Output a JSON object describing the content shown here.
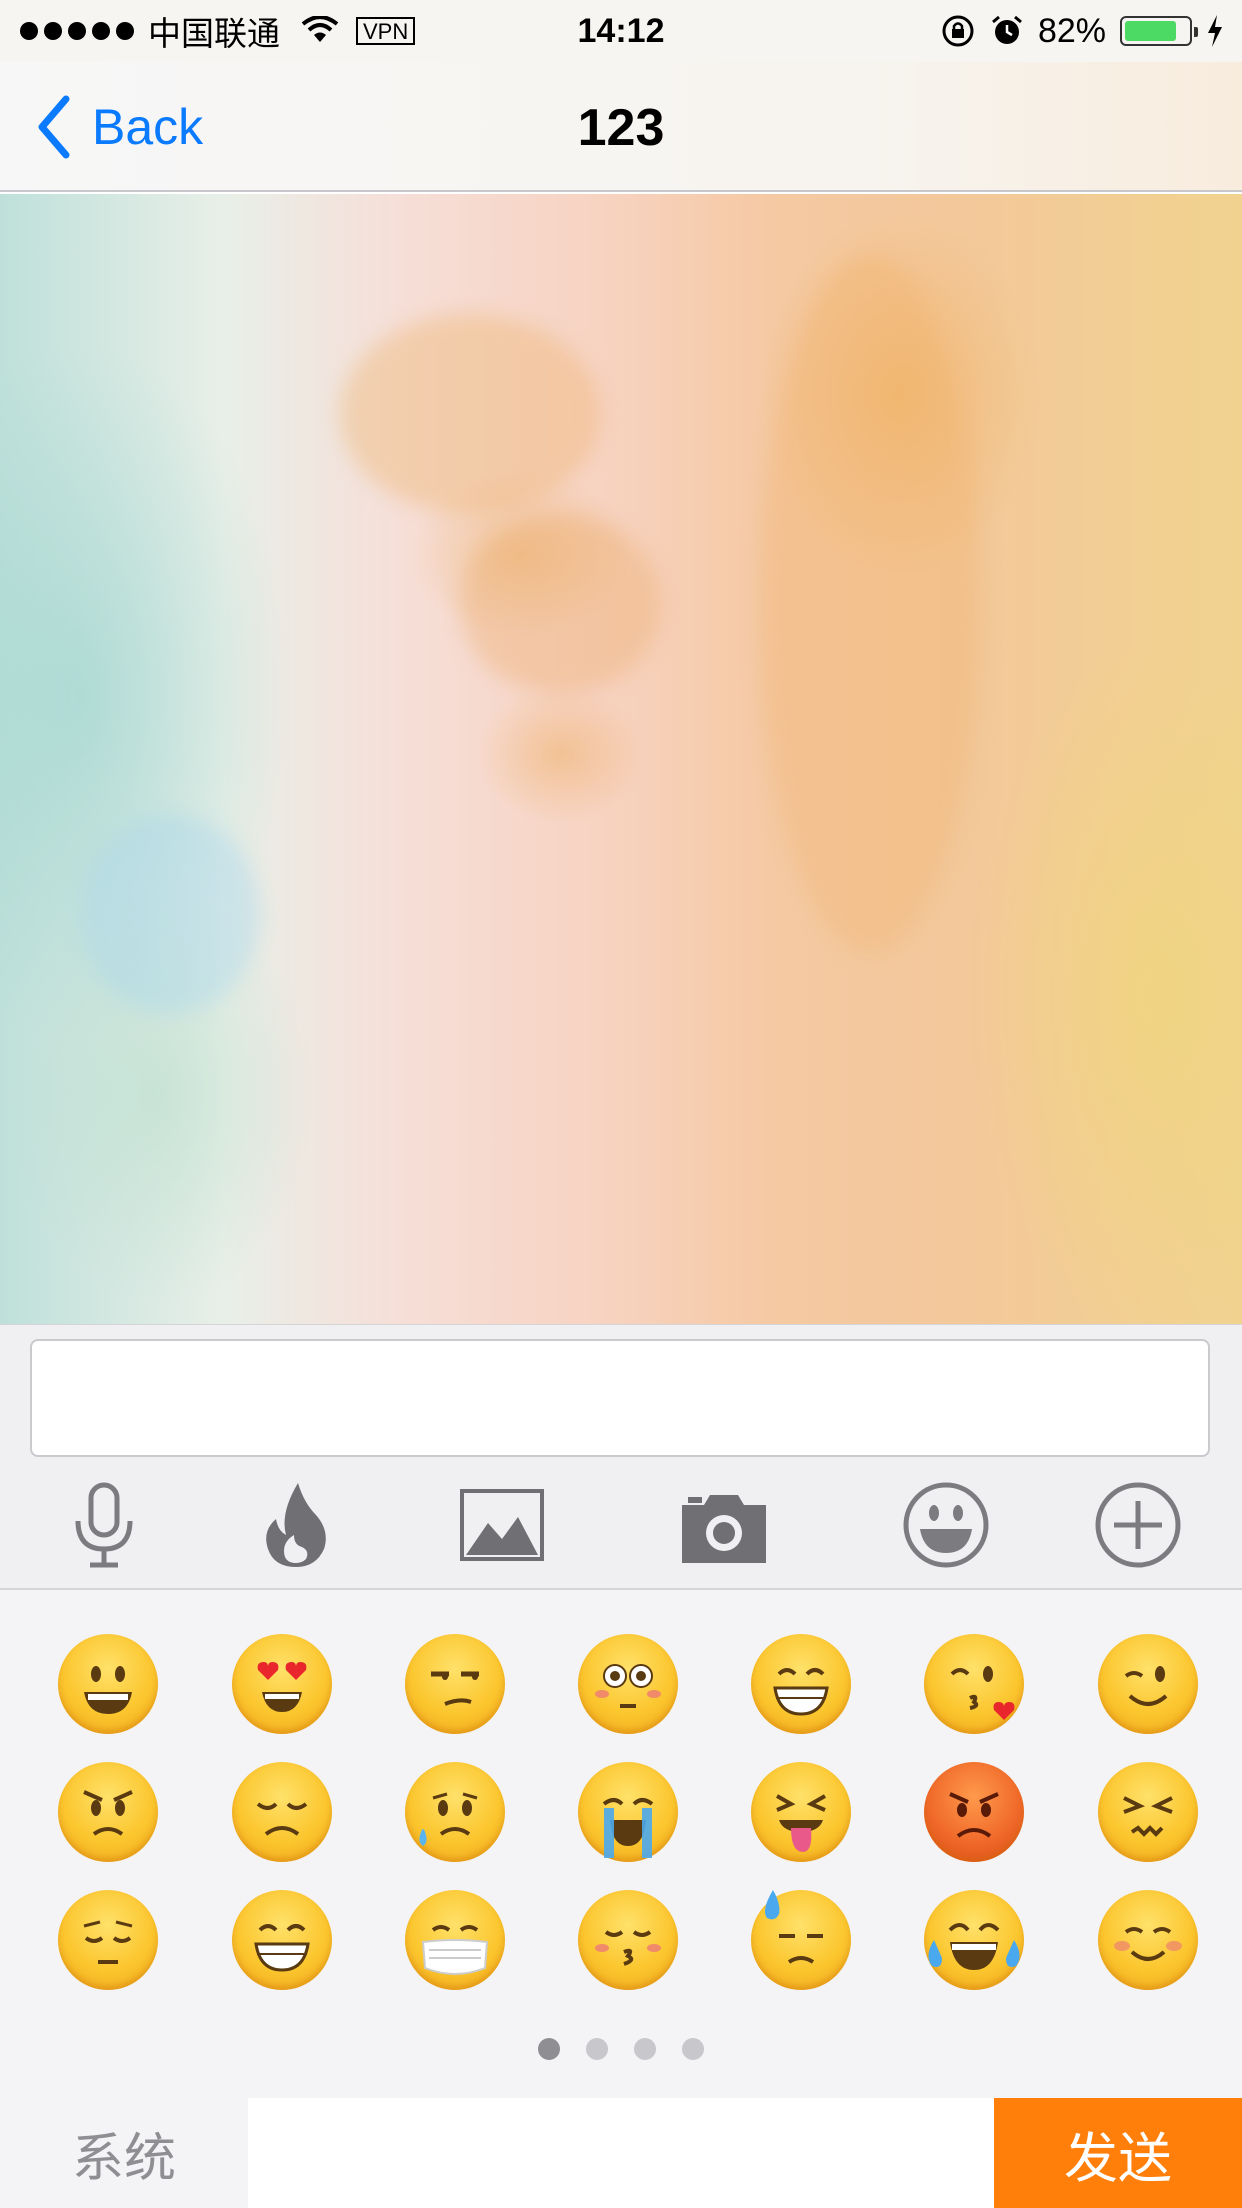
{
  "status_bar": {
    "carrier": "中国联通",
    "vpn": "VPN",
    "time": "14:12",
    "battery_percent": "82%",
    "battery_level": 0.82,
    "icons": [
      "signal-dots-icon",
      "wifi-icon",
      "rotation-lock-icon",
      "alarm-icon",
      "battery-icon",
      "charging-icon"
    ]
  },
  "nav": {
    "back_label": "Back",
    "title": "123",
    "accent_color": "#0a7aff"
  },
  "input": {
    "value": "",
    "placeholder": ""
  },
  "toolbar": {
    "tools": [
      "microphone-icon",
      "fire-icon",
      "image-icon",
      "camera-icon",
      "emoji-icon",
      "plus-icon"
    ]
  },
  "emoji_panel": {
    "rows": [
      [
        "grinning",
        "heart-eyes",
        "unamused",
        "flushed",
        "grin",
        "kissing-heart",
        "wink"
      ],
      [
        "angry",
        "disappointed",
        "sad-sweat",
        "sob",
        "tongue-squint",
        "pouting-red",
        "confounded"
      ],
      [
        "pensive",
        "grin",
        "mask",
        "kissing-closed-eyes",
        "sweat",
        "joy",
        "blush"
      ]
    ],
    "pages": 4,
    "current_page": 1
  },
  "bottom_bar": {
    "system_label": "系统",
    "send_label": "发送",
    "send_color": "#ff7f0a"
  }
}
